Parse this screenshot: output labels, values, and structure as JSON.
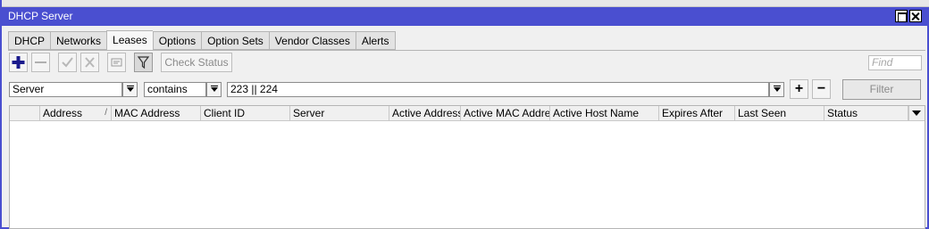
{
  "window": {
    "title": "DHCP Server",
    "accent": "#4a4fd0"
  },
  "tabs": [
    {
      "label": "DHCP",
      "active": false
    },
    {
      "label": "Networks",
      "active": false
    },
    {
      "label": "Leases",
      "active": true
    },
    {
      "label": "Options",
      "active": false
    },
    {
      "label": "Option Sets",
      "active": false
    },
    {
      "label": "Vendor Classes",
      "active": false
    },
    {
      "label": "Alerts",
      "active": false
    }
  ],
  "toolbar": {
    "add_icon": "plus-icon",
    "remove_icon": "minus-icon",
    "enable_icon": "check-icon",
    "disable_icon": "cross-icon",
    "comment_icon": "comment-icon",
    "filter_icon": "filter-icon",
    "check_status_label": "Check Status",
    "find_placeholder": "Find"
  },
  "filter": {
    "field": "Server",
    "operator": "contains",
    "value": "223 || 224",
    "add_label": "+",
    "remove_label": "−",
    "button_label": "Filter"
  },
  "table": {
    "columns": [
      "",
      "Address",
      "MAC Address",
      "Client ID",
      "Server",
      "Active Address",
      "Active MAC Addre...",
      "Active Host Name",
      "Expires After",
      "Last Seen",
      "Status"
    ],
    "sort_indicator": "/",
    "rows": []
  }
}
